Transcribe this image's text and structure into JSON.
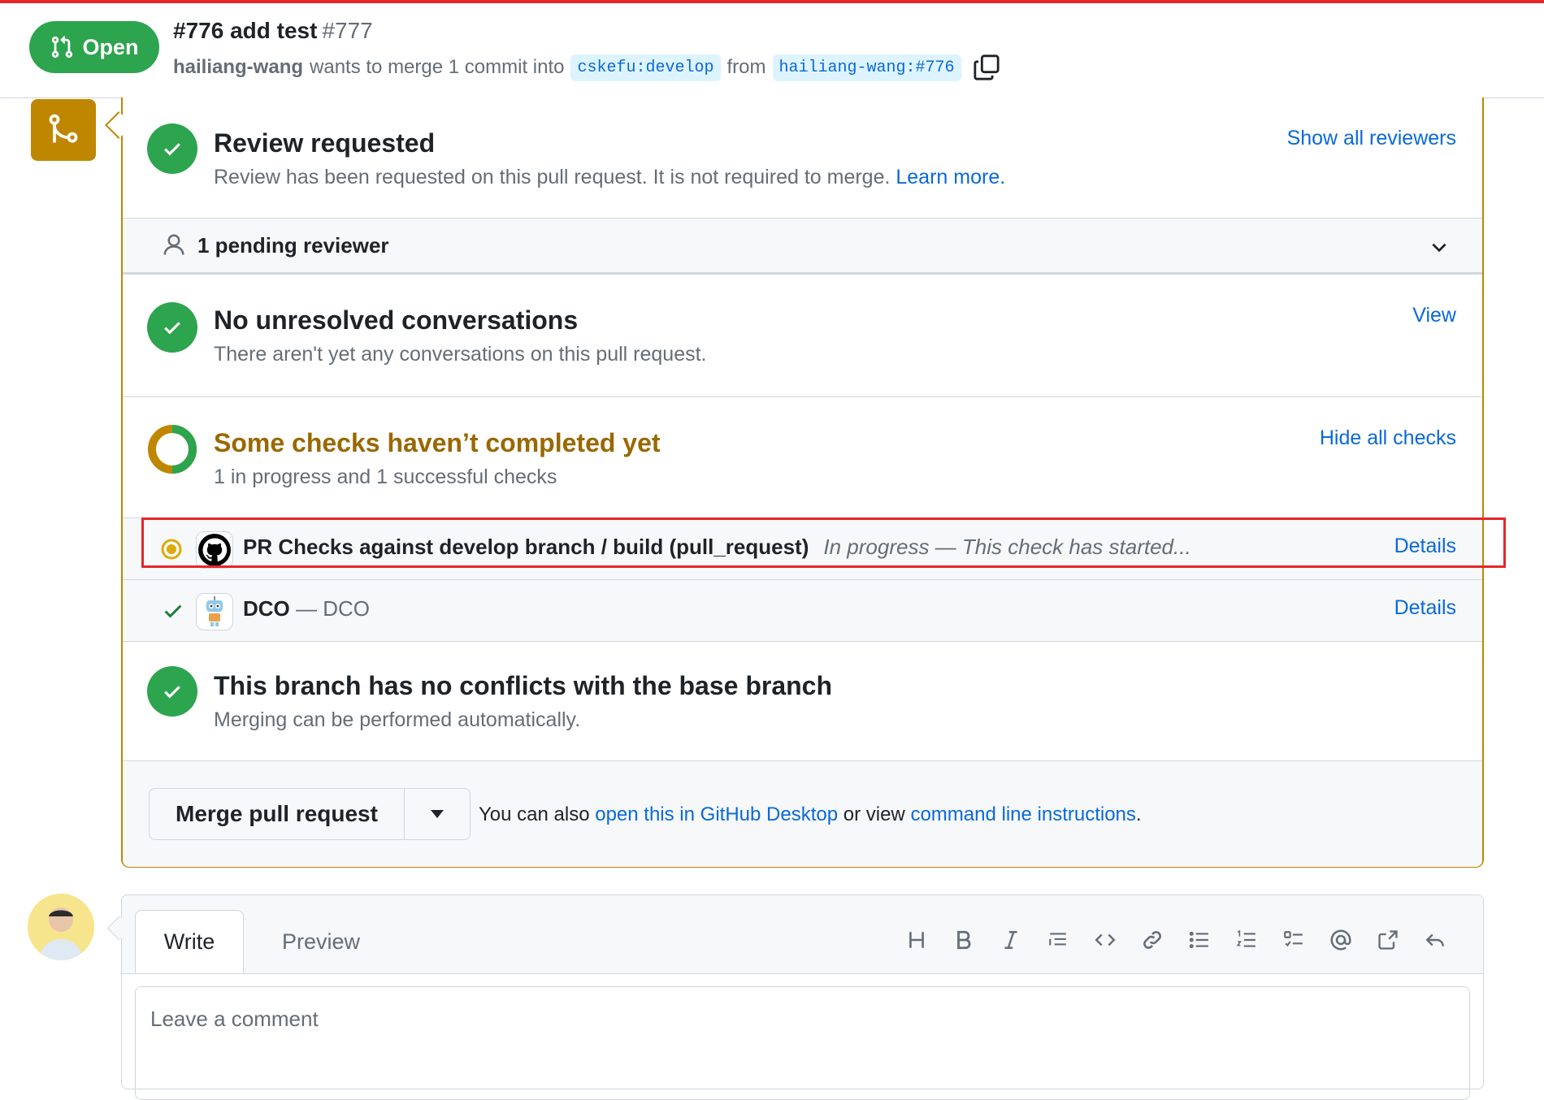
{
  "header": {
    "state": "Open",
    "title": "#776 add test",
    "number": "#777",
    "author": "hailiang-wang",
    "meta_text": "wants to merge 1 commit into",
    "base_branch": "cskefu:develop",
    "from_text": "from",
    "head_branch": "hailiang-wang:#776"
  },
  "review": {
    "title": "Review requested",
    "subtitle": "Review has been requested on this pull request. It is not required to merge.",
    "learn_more": "Learn more.",
    "action": "Show all reviewers",
    "pending": "1 pending reviewer"
  },
  "conversations": {
    "title": "No unresolved conversations",
    "subtitle": "There aren't yet any conversations on this pull request.",
    "action": "View"
  },
  "checks": {
    "title": "Some checks haven’t completed yet",
    "subtitle": "1 in progress and 1 successful checks",
    "action": "Hide all checks",
    "items": [
      {
        "name": "PR Checks against develop branch / build (pull_request)",
        "desc": "In progress — This check has started...",
        "details": "Details",
        "status": "in-progress"
      },
      {
        "name": "DCO",
        "desc": "— DCO",
        "details": "Details",
        "status": "success"
      }
    ]
  },
  "conflicts": {
    "title": "This branch has no conflicts with the base branch",
    "subtitle": "Merging can be performed automatically."
  },
  "merge": {
    "button": "Merge pull request",
    "help_prefix": "You can also",
    "desktop_link": "open this in GitHub Desktop",
    "help_mid": "or view",
    "cli_link": "command line instructions",
    "help_suffix": "."
  },
  "comment": {
    "tab_write": "Write",
    "tab_preview": "Preview",
    "placeholder": "Leave a comment"
  },
  "colors": {
    "success": "#2da44e",
    "attention": "#bf8700",
    "accent": "#0969da",
    "highlight": "#e5262b"
  }
}
